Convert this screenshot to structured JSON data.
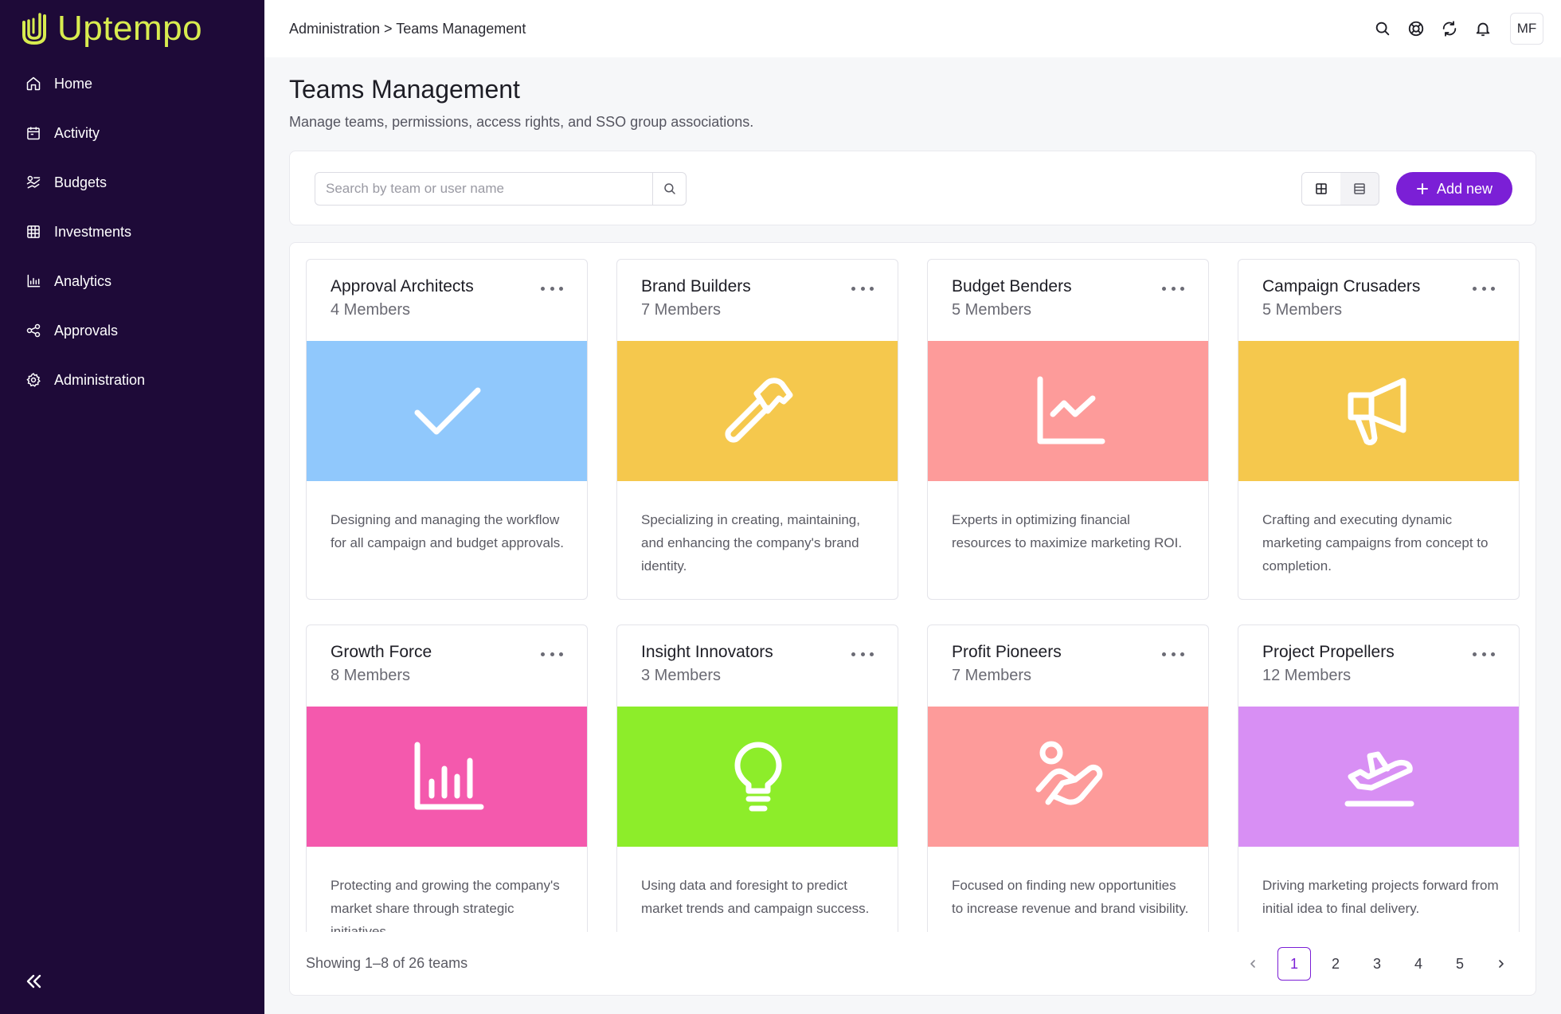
{
  "app": {
    "name": "Uptempo"
  },
  "sidebar": {
    "items": [
      {
        "label": "Home",
        "icon": "home-icon"
      },
      {
        "label": "Activity",
        "icon": "calendar-icon"
      },
      {
        "label": "Budgets",
        "icon": "budgets-icon"
      },
      {
        "label": "Investments",
        "icon": "table-icon"
      },
      {
        "label": "Analytics",
        "icon": "bar-chart-icon"
      },
      {
        "label": "Approvals",
        "icon": "share-nodes-icon"
      },
      {
        "label": "Administration",
        "icon": "gear-icon"
      }
    ]
  },
  "header": {
    "breadcrumb": "Administration > Teams Management",
    "user_initials": "MF"
  },
  "page": {
    "title": "Teams Management",
    "subtitle": "Manage teams, permissions, access rights, and SSO group associations."
  },
  "toolbar": {
    "search_placeholder": "Search by team or user name",
    "add_label": "Add new"
  },
  "teams": [
    {
      "name": "Approval Architects",
      "members": "4 Members",
      "color": "#90c8fc",
      "icon": "check-icon",
      "description": "Designing and managing the workflow for all campaign and budget approvals."
    },
    {
      "name": "Brand Builders",
      "members": "7 Members",
      "color": "#f5c84d",
      "icon": "hammer-icon",
      "description": "Specializing in creating, maintaining, and enhancing the company's brand identity."
    },
    {
      "name": "Budget Benders",
      "members": "5 Members",
      "color": "#fd9b9a",
      "icon": "line-chart-icon",
      "description": "Experts in optimizing financial resources to maximize marketing ROI."
    },
    {
      "name": "Campaign Crusaders",
      "members": "5 Members",
      "color": "#f5c84d",
      "icon": "megaphone-icon",
      "description": "Crafting and executing dynamic marketing campaigns from concept to completion."
    },
    {
      "name": "Growth Force",
      "members": "8 Members",
      "color": "#f459ad",
      "icon": "bar-chart-icon",
      "description": "Protecting and growing the company's market share through strategic initiatives."
    },
    {
      "name": "Insight Innovators",
      "members": "3 Members",
      "color": "#8ded2a",
      "icon": "lightbulb-icon",
      "description": "Using data and foresight to predict market trends and campaign success."
    },
    {
      "name": "Profit Pioneers",
      "members": "7 Members",
      "color": "#fd9b9a",
      "icon": "hand-coin-icon",
      "description": "Focused on finding new opportunities to increase revenue and brand visibility."
    },
    {
      "name": "Project Propellers",
      "members": "12 Members",
      "color": "#d88ff4",
      "icon": "plane-takeoff-icon",
      "description": "Driving marketing projects forward from initial idea to final delivery."
    }
  ],
  "footer": {
    "showing": "Showing 1–8 of 26 teams",
    "pages": [
      "1",
      "2",
      "3",
      "4",
      "5"
    ],
    "current_page": "1"
  }
}
